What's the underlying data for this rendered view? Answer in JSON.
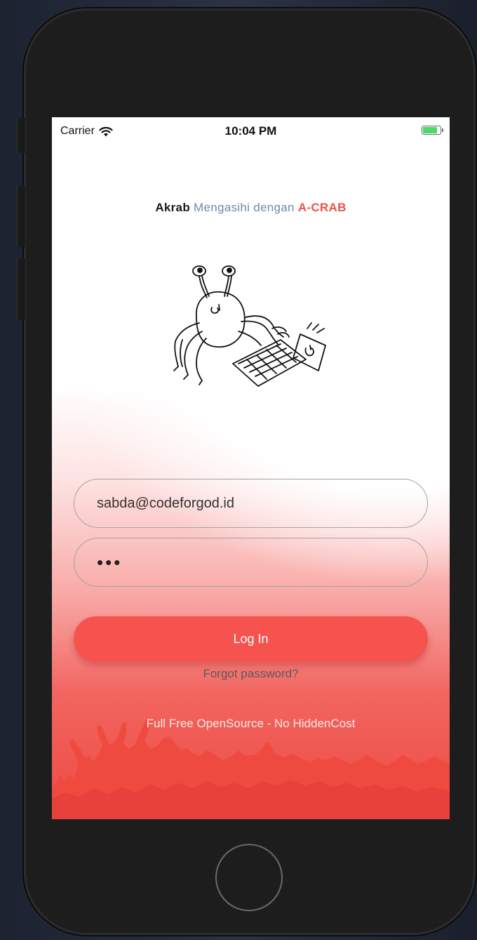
{
  "statusbar": {
    "carrier": "Carrier",
    "time": "10:04 PM",
    "battery_fill_fraction": 0.85,
    "battery_color": "#4cd964"
  },
  "headline": {
    "part1": "Akrab",
    "part2": "Mengasihi dengan",
    "part3": "A-CRAB"
  },
  "mascot": {
    "icon": "crab-typing-laptop-illustration"
  },
  "login": {
    "email_value": "sabda@codeforgod.id",
    "password_value": "•••",
    "button_label": "Log In",
    "forgot_label": "Forgot password?"
  },
  "footer": {
    "tagline": "Full Free OpenSource - No HiddenCost",
    "crowd_icon": "cheering-crowd-silhouette"
  },
  "colors": {
    "accent": "#f6524e",
    "brand": "#f0504a",
    "headline_mid": "#6b8ba8"
  }
}
